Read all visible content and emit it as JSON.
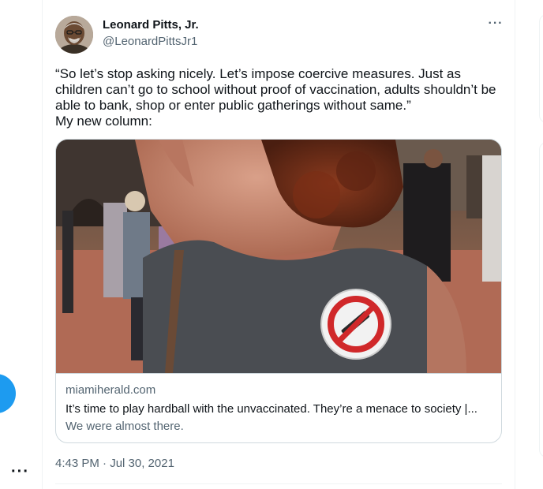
{
  "tweet": {
    "display_name": "Leonard Pitts, Jr.",
    "handle": "@LeonardPittsJr1",
    "more_label": "···",
    "text_line1": "“So let’s stop asking nicely. Let’s impose coercive measures. Just as children can’t go to school without proof of vaccination, adults shouldn’t be able to bank, shop or enter public gatherings without same.”",
    "text_line2": "My new column:",
    "timestamp": "4:43 PM · Jul 30, 2021"
  },
  "card": {
    "domain": "miamiherald.com",
    "title": "It’s time to play hardball with the unvaccinated. They’re a menace to society |...",
    "description": "We were almost there."
  },
  "left_rail": {
    "more_label": "···"
  },
  "colors": {
    "accent": "#1d9bf0",
    "text_primary": "#0f1419",
    "text_secondary": "#536471",
    "border": "#cfd9de"
  },
  "icons": {
    "more": "more-horizontal-icon",
    "badge": "no-vaccine-badge"
  }
}
